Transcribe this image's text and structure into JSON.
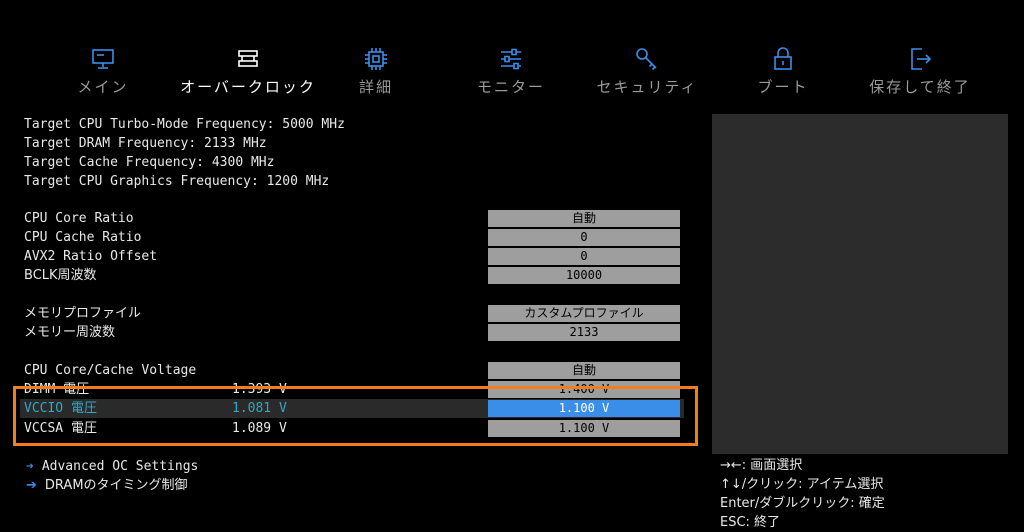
{
  "nav": {
    "tabs": [
      {
        "label": "メイン",
        "icon": "monitor-icon",
        "active": false
      },
      {
        "label": "オーバークロック",
        "icon": "memory-module-icon",
        "active": true
      },
      {
        "label": "詳細",
        "icon": "cpu-chip-icon",
        "active": false
      },
      {
        "label": "モニター",
        "icon": "sliders-icon",
        "active": false
      },
      {
        "label": "セキュリティ",
        "icon": "key-icon",
        "active": false
      },
      {
        "label": "ブート",
        "icon": "lock-icon",
        "active": false
      },
      {
        "label": "保存して終了",
        "icon": "exit-door-icon",
        "active": false
      }
    ]
  },
  "info": [
    "Target CPU Turbo-Mode Frequency: 5000 MHz",
    "Target DRAM Frequency: 2133 MHz",
    "Target Cache Frequency: 4300 MHz",
    "Target CPU Graphics Frequency: 1200 MHz"
  ],
  "settings": {
    "cpu_core_ratio": {
      "label": "CPU Core Ratio",
      "value": "自動"
    },
    "cpu_cache_ratio": {
      "label": "CPU Cache Ratio",
      "value": "0"
    },
    "avx2_ratio_offset": {
      "label": "AVX2 Ratio Offset",
      "value": "0"
    },
    "bclk": {
      "label": "BCLK周波数",
      "value": "10000"
    },
    "memory_profile": {
      "label": "メモリプロファイル",
      "value": "カスタムプロファイル"
    },
    "memory_freq": {
      "label": "メモリー周波数",
      "value": "2133"
    },
    "cpu_core_cache_voltage": {
      "label": "CPU Core/Cache Voltage",
      "value": "自動"
    },
    "dimm_voltage": {
      "label": "DIMM 電圧",
      "current": "1.393 V",
      "value": "1.400 V"
    },
    "vccio_voltage": {
      "label": "VCCIO 電圧",
      "current": "1.081 V",
      "value": "1.100 V"
    },
    "vccsa_voltage": {
      "label": "VCCSA 電圧",
      "current": "1.089 V",
      "value": "1.100 V"
    }
  },
  "links": [
    {
      "arrow": "➔",
      "label": "Advanced OC Settings"
    },
    {
      "arrow": "➔",
      "label": "DRAMのタイミング制御"
    }
  ],
  "help": [
    "→←: 画面選択",
    "↑↓/クリック: アイテム選択",
    "Enter/ダブルクリック: 確定",
    "ESC: 終了"
  ],
  "colors": {
    "accent": "#3b8ee8",
    "highlight_border": "#f07d1e",
    "selected_text": "#2fa8c8"
  }
}
